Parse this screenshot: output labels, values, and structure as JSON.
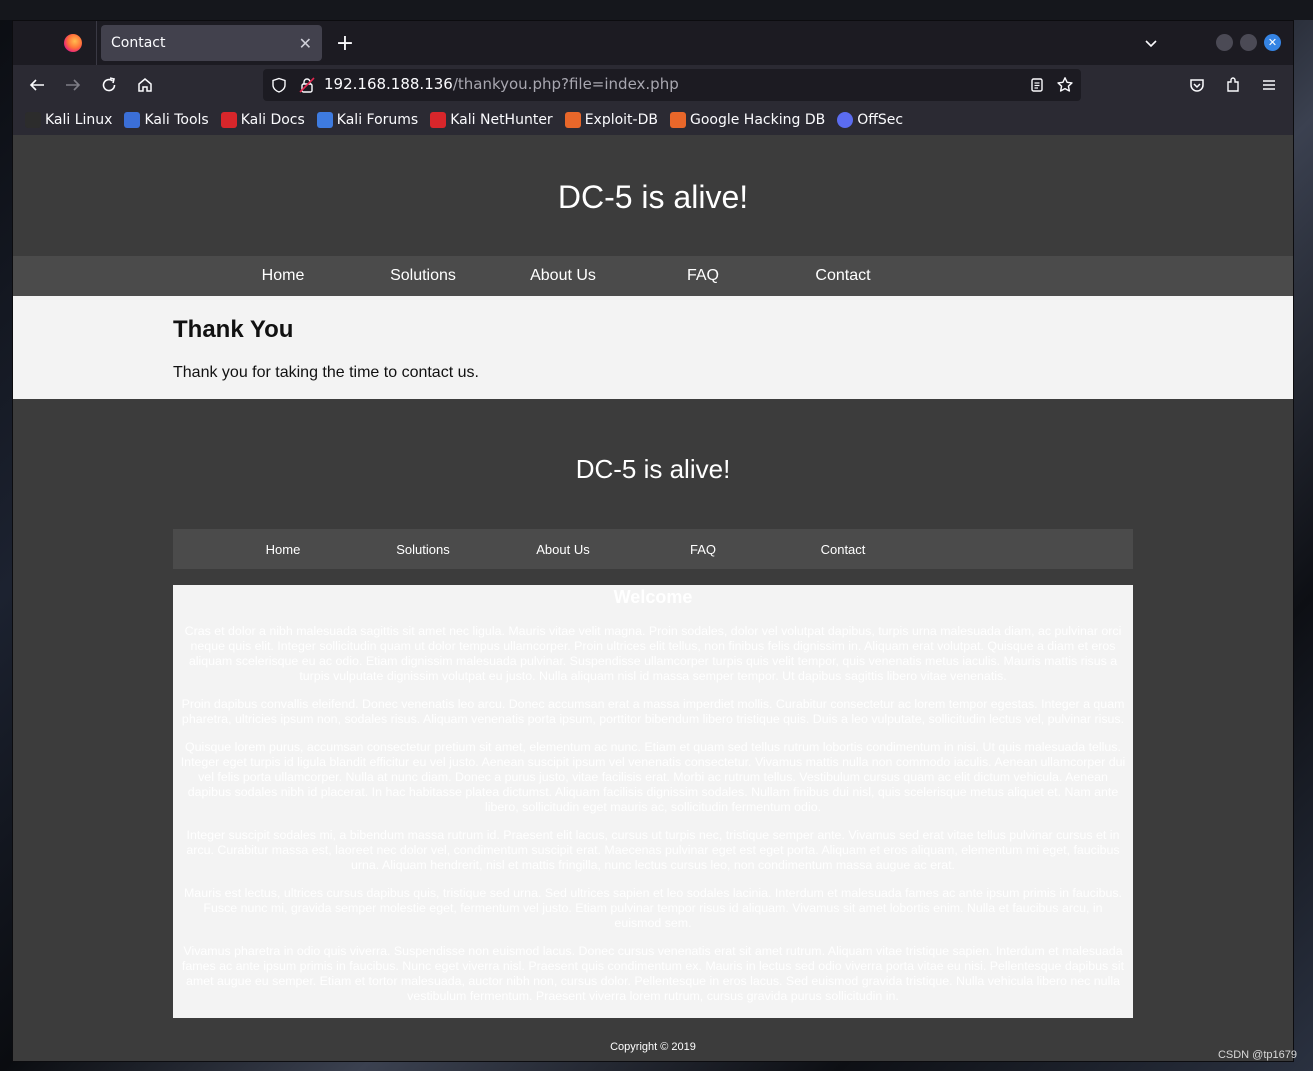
{
  "browser": {
    "tab_title": "Contact",
    "url_host": "192.168.188.136",
    "url_path": "/thankyou.php?file=index.php",
    "bookmarks": [
      {
        "label": "Kali Linux",
        "color": "#2c2c2c"
      },
      {
        "label": "Kali Tools",
        "color": "#3b6fd8"
      },
      {
        "label": "Kali Docs",
        "color": "#d8262b"
      },
      {
        "label": "Kali Forums",
        "color": "#3e7be0"
      },
      {
        "label": "Kali NetHunter",
        "color": "#d8262b"
      },
      {
        "label": "Exploit-DB",
        "color": "#e8672a"
      },
      {
        "label": "Google Hacking DB",
        "color": "#e8672a"
      },
      {
        "label": "OffSec",
        "color": "#5b6cf0"
      }
    ]
  },
  "site": {
    "title": "DC-5 is alive!",
    "menu": [
      "Home",
      "Solutions",
      "About Us",
      "FAQ",
      "Contact"
    ],
    "heading": "Thank You",
    "message": "Thank you for taking the time to contact us.",
    "footer_title": "DC-5 is alive!",
    "footer_menu": [
      "Home",
      "Solutions",
      "About Us",
      "FAQ",
      "Contact"
    ],
    "welcome_heading": "Welcome",
    "welcome_paragraphs": [
      "Cras et dolor a nibh malesuada sagittis sit amet nec ligula. Mauris vitae velit magna. Proin sodales, dolor vel volutpat dapibus, turpis urna malesuada diam, ac pulvinar orci neque quis elit. Integer sollicitudin quam ut dolor tempus ullamcorper. Proin ultrices elit tellus, non finibus felis dignissim in. Aliquam erat volutpat. Quisque a diam et eros aliquam scelerisque eu ac odio. Etiam dignissim malesuada pulvinar. Suspendisse ullamcorper turpis quis velit tempor, quis venenatis metus iaculis. Mauris mattis risus a turpis vulputate dignissim volutpat eu justo. Nulla aliquam nisl id massa semper tempor. Ut dapibus sagittis libero vitae venenatis.",
      "Proin dapibus convallis eleifend. Donec venenatis leo arcu. Donec accumsan erat a massa imperdiet mollis. Curabitur consectetur ac lorem tempor egestas. Integer a quam pharetra, ultricies ipsum non, sodales risus. Aliquam venenatis porta ipsum, porttitor bibendum libero tristique quis. Duis a leo vulputate, sollicitudin lectus vel, pulvinar risus.",
      "Quisque lorem purus, accumsan consectetur pretium sit amet, elementum ac nunc. Etiam et quam sed tellus rutrum lobortis condimentum in nisi. Ut quis malesuada tellus. Integer eget turpis id ligula blandit efficitur eu vel justo. Aenean suscipit ipsum vel venenatis consectetur. Vivamus mattis nulla non commodo iaculis. Aenean ullamcorper dui vel felis porta ullamcorper. Nulla at nunc diam. Donec a purus justo, vitae facilisis erat. Morbi ac rutrum tellus. Vestibulum cursus quam ac elit dictum vehicula. Aenean dapibus sodales nibh id placerat. In hac habitasse platea dictumst. Aliquam facilisis dignissim sodales. Nullam finibus dui nisl, quis scelerisque metus aliquet et. Nam ante libero, sollicitudin eget mauris ac, sollicitudin fermentum odio.",
      "Integer suscipit sodales mi, a bibendum massa rutrum id. Praesent elit lacus, cursus ut turpis nec, tristique semper ante. Vivamus sed erat vitae tellus pulvinar cursus et in arcu. Curabitur massa est, laoreet nec dolor vel, condimentum suscipit erat. Maecenas pulvinar eget est eget porta. Aliquam et eros aliquam, elementum mi eget, faucibus urna. Aliquam hendrerit, nisl et mattis fringilla, nunc lectus cursus leo, non condimentum massa augue ac erat.",
      "Mauris est lectus, ultrices cursus dapibus quis, tristique sed urna. Sed ultrices sapien et leo sodales lacinia. Interdum et malesuada fames ac ante ipsum primis in faucibus. Fusce nunc mi, gravida semper molestie eget, fermentum vel justo. Etiam pulvinar tempor risus id aliquam. Vivamus sit amet lobortis enim. Nulla et faucibus arcu, in euismod sem.",
      "Vivamus pharetra in odio quis viverra. Suspendisse non euismod lacus. Donec cursus venenatis erat sit amet rutrum. Aliquam vitae tristique sapien. Interdum et malesuada fames ac ante ipsum primis in faucibus. Nunc eget viverra nisl. Praesent quis condimentum ex. Mauris in lectus sed odio viverra porta vitae eu nisi. Pellentesque dapibus sit amet augue eu semper. Etiam et tortor malesuada, auctor nibh non, cursus dolor. Pellentesque in eros lacus. Sed euismod gravida tristique. Nulla vehicula libero nec nulla vestibulum fermentum. Praesent viverra lorem rutrum, cursus gravida purus sollicitudin in."
    ],
    "copyright": "Copyright © 2019"
  },
  "watermark": "CSDN @tp1679"
}
